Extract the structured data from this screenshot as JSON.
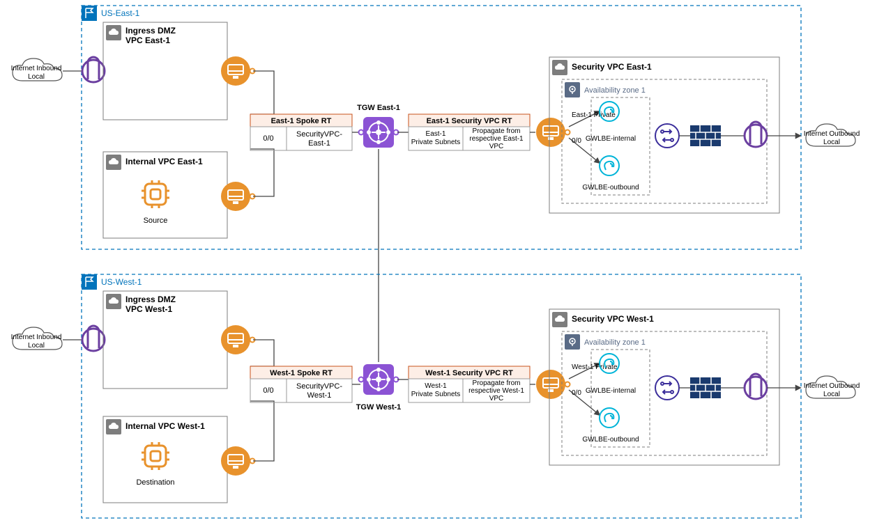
{
  "east": {
    "region": "US-East-1",
    "dmz": {
      "l1": "Ingress DMZ",
      "l2": "VPC East-1"
    },
    "internal": "Internal VPC East-1",
    "compute": "Source",
    "spoke": {
      "header": "East-1 Spoke RT",
      "c1": "0/0",
      "c2_1": "SecurityVPC-",
      "c2_2": "East-1"
    },
    "tgw": "TGW East-1",
    "secrt": {
      "header": "East-1 Security VPC RT",
      "c1_1": "East-1",
      "c1_2": "Private Subnets",
      "c2_1": "Propagate from",
      "c2_2": "respective East-1",
      "c2_3": "VPC"
    },
    "secvpc": "Security VPC East-1",
    "az": "Availability zone 1",
    "priv": "East-1 Private",
    "zero": "0/0",
    "gi": "GWLBE-internal",
    "go": "GWLBE-outbound",
    "inbound": {
      "l1": "Internet Inbound",
      "l2": "Local"
    },
    "outbound": {
      "l1": "Internet Outbound",
      "l2": "Local"
    }
  },
  "west": {
    "region": "US-West-1",
    "dmz": {
      "l1": "Ingress DMZ",
      "l2": "VPC West-1"
    },
    "internal": "Internal VPC West-1",
    "compute": "Destination",
    "spoke": {
      "header": "West-1 Spoke RT",
      "c1": "0/0",
      "c2_1": "SecurityVPC-",
      "c2_2": "West-1"
    },
    "tgw": "TGW West-1",
    "secrt": {
      "header": "West-1 Security VPC RT",
      "c1_1": "West-1",
      "c1_2": "Private Subnets",
      "c2_1": "Propagate from",
      "c2_2": "respective West-1",
      "c2_3": "VPC"
    },
    "secvpc": "Security VPC West-1",
    "az": "Availability zone 1",
    "priv": "West-1 Private",
    "zero": "0/0",
    "gi": "GWLBE-internal",
    "go": "GWLBE-outbound",
    "inbound": {
      "l1": "Internet Inbound",
      "l2": "Local"
    },
    "outbound": {
      "l1": "Internet Outbound",
      "l2": "Local"
    }
  }
}
